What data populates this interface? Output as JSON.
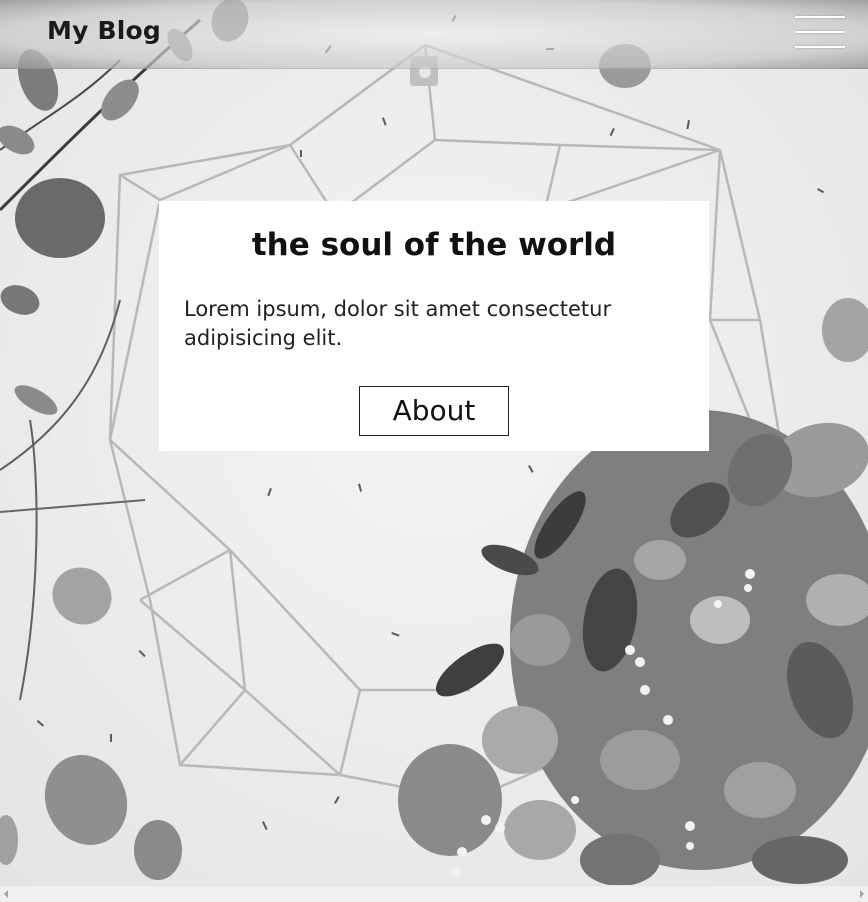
{
  "header": {
    "brand": "My Blog",
    "menu_icon": "hamburger-icon"
  },
  "hero": {
    "title": "the soul of the world",
    "text": "Lorem ipsum, dolor sit amet consectetur adipisicing elit.",
    "button_label": "About"
  },
  "scrollbar": {
    "left_icon": "arrow-left-icon",
    "right_icon": "arrow-right-icon"
  },
  "colors": {
    "card_background": "#ffffff",
    "text": "#111111",
    "menu_bars": "#ffffff"
  }
}
